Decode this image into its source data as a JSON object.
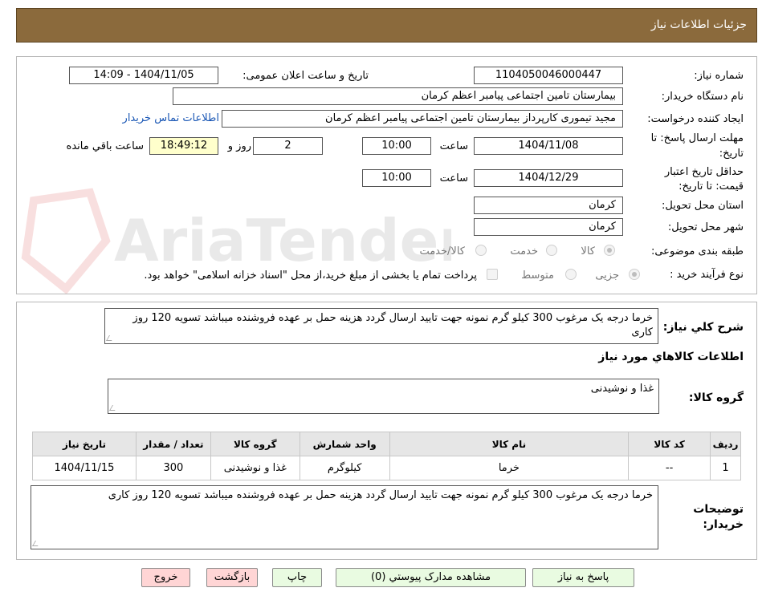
{
  "header": {
    "title": "جزئیات اطلاعات نیاز"
  },
  "fields": {
    "need_number_label": "شماره نیاز:",
    "need_number": "1104050046000447",
    "announce_label": "تاریخ و ساعت اعلان عمومی:",
    "announce_value": "1404/11/05 - 14:09",
    "buyer_org_label": "نام دستگاه خریدار:",
    "buyer_org": "بیمارستان تامین اجتماعی پیامبر اعظم کرمان",
    "creator_label": "ایجاد کننده درخواست:",
    "creator": "مجید تیموری کارپرداز بیمارستان تامین اجتماعی پیامبر اعظم کرمان",
    "contact_link": "اطلاعات تماس خریدار",
    "deadline_label_1": "مهلت ارسال پاسخ: تا",
    "deadline_label_2": "تاریخ:",
    "deadline_date": "1404/11/08",
    "time_label": "ساعت",
    "deadline_time": "10:00",
    "days_value": "2",
    "days_label": "روز و",
    "remaining_time": "18:49:12",
    "remaining_label": "ساعت باقي مانده",
    "validity_label_1": "حداقل تاریخ اعتبار",
    "validity_label_2": "قیمت: تا تاریخ:",
    "validity_date": "1404/12/29",
    "validity_time_label": "ساعت",
    "validity_time": "10:00",
    "province_label": "استان محل تحویل:",
    "province": "کرمان",
    "city_label": "شهر محل تحویل:",
    "city": "کرمان",
    "category_label": "طبقه بندی موضوعی:",
    "category_options": [
      "کالا",
      "خدمت",
      "کالا/خدمت"
    ],
    "process_label": "نوع فرآیند خرید :",
    "process_options": [
      "جزیی",
      "متوسط"
    ],
    "payment_note": "پرداخت تمام یا بخشی از مبلغ خرید،از محل \"اسناد خزانه اسلامی\" خواهد بود."
  },
  "summary": {
    "label": "شرح کلي نیاز:",
    "text": "خرما درجه یک مرغوب 300 کیلو گرم نمونه جهت تایید ارسال گردد هزینه حمل بر عهده فروشنده میباشد تسویه 120 روز کاری"
  },
  "goods_section": {
    "title": "اطلاعات کالاهاي مورد نیاز",
    "group_label": "گروه کالا:",
    "group_value": "غذا و نوشیدنی"
  },
  "table": {
    "headers": [
      "ردیف",
      "کد کالا",
      "نام کالا",
      "واحد شمارش",
      "گروه کالا",
      "تعداد / مقدار",
      "تاریخ نیاز"
    ],
    "rows": [
      [
        "1",
        "--",
        "خرما",
        "کیلوگرم",
        "غذا و نوشیدنی",
        "300",
        "1404/11/15"
      ]
    ]
  },
  "buyer_notes": {
    "label_1": "توضیحات",
    "label_2": "خریدار:",
    "text": "خرما درجه یک مرغوب 300 کیلو گرم نمونه جهت تایید ارسال گردد هزینه حمل بر عهده فروشنده میباشد تسویه 120 روز کاری"
  },
  "buttons": {
    "respond": "پاسخ به نیاز",
    "attachments": "مشاهده مدارک پیوستي (0)",
    "print": "چاپ",
    "back": "بازگشت",
    "exit": "خروج"
  },
  "watermark": {
    "text": "AriaTender.net"
  },
  "colors": {
    "header_bg": "#8B6A3C",
    "link": "#1a57b5",
    "remaining_bg": "#FFFFCC",
    "green_button": "#e9fbe1",
    "pink_button": "#ffd5d5"
  }
}
